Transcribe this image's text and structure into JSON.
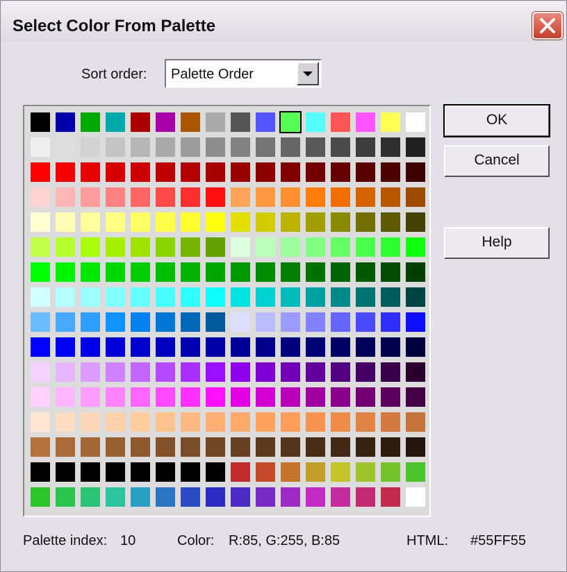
{
  "window": {
    "title": "Select Color From Palette",
    "close_icon": "close-icon"
  },
  "sort": {
    "label": "Sort order:",
    "value": "Palette Order"
  },
  "buttons": {
    "ok": "OK",
    "cancel": "Cancel",
    "help": "Help"
  },
  "status": {
    "index_label": "Palette index:",
    "index_value": "10",
    "color_label": "Color:",
    "color_value": "R:85, G:255, B:85",
    "html_label": "HTML:",
    "html_value": "#55FF55"
  },
  "palette": {
    "selected_index": 10,
    "rows": [
      [
        "#000000",
        "#0000aa",
        "#00aa00",
        "#00aaaa",
        "#aa0000",
        "#aa00aa",
        "#aa5500",
        "#aaaaaa",
        "#555555",
        "#5555ff",
        "#55ff55",
        "#55ffff",
        "#ff5555",
        "#ff55ff",
        "#ffff55",
        "#ffffff"
      ],
      [
        "#efefef",
        "#dedede",
        "#d2d2d2",
        "#c3c3c3",
        "#b6b6b6",
        "#aaaaaa",
        "#9d9d9d",
        "#8e8e8e",
        "#828282",
        "#757575",
        "#656565",
        "#595959",
        "#4a4a4a",
        "#3d3d3d",
        "#2f2f2f",
        "#202020"
      ],
      [
        "#ff0000",
        "#f40000",
        "#e70000",
        "#d90000",
        "#cd0000",
        "#bf0000",
        "#b30000",
        "#a60000",
        "#990000",
        "#8c0000",
        "#7f0000",
        "#720000",
        "#650000",
        "#590000",
        "#4c0000",
        "#3f0000"
      ],
      [
        "#ffd2d2",
        "#ffb6b6",
        "#ff9c9c",
        "#ff8282",
        "#ff6565",
        "#ff4a4a",
        "#ff2f2f",
        "#ff0f0f",
        "#ffa55a",
        "#ff9841",
        "#ff8f2f",
        "#ff7b0a",
        "#ef6f00",
        "#d46400",
        "#b75700",
        "#9c4b00"
      ],
      [
        "#ffffd2",
        "#ffffb6",
        "#ffff9c",
        "#ffff82",
        "#ffff65",
        "#ffff4a",
        "#ffff2f",
        "#ffff0f",
        "#e3e000",
        "#d2cc00",
        "#bbb300",
        "#a19f00",
        "#8a8a00",
        "#736f00",
        "#5d5a00",
        "#444200"
      ],
      [
        "#c3ff4a",
        "#b6ff2f",
        "#aaff0f",
        "#a5ef00",
        "#9ee300",
        "#8ad400",
        "#76b500",
        "#63a100",
        "#ddffdd",
        "#bbffbb",
        "#9cff9c",
        "#82ff82",
        "#65ff65",
        "#4aff4a",
        "#2fff2f",
        "#0fff0f"
      ],
      [
        "#00ff00",
        "#00f400",
        "#00e700",
        "#00d900",
        "#00cd00",
        "#00bf00",
        "#00b300",
        "#00a600",
        "#009900",
        "#008c00",
        "#007f00",
        "#007200",
        "#006500",
        "#005900",
        "#004c00",
        "#003f00"
      ],
      [
        "#d2ffff",
        "#b6ffff",
        "#9cffff",
        "#82ffff",
        "#65ffff",
        "#4affff",
        "#2fffff",
        "#0fffff",
        "#00e3e3",
        "#00d2d2",
        "#00bbbb",
        "#00a1a1",
        "#008a8a",
        "#007373",
        "#005d5d",
        "#004444"
      ],
      [
        "#6bbcff",
        "#47aaff",
        "#2f9fff",
        "#0f93ff",
        "#0083ef",
        "#0077d4",
        "#0068b7",
        "#005a9c",
        "#ddddff",
        "#bbbbff",
        "#9c9cff",
        "#8282ff",
        "#6565ff",
        "#4a4aff",
        "#2f2fff",
        "#0f0fff"
      ],
      [
        "#0000ff",
        "#0000f4",
        "#0000e7",
        "#0000d9",
        "#0000cd",
        "#0000bf",
        "#0000b3",
        "#0000a6",
        "#000099",
        "#00008c",
        "#00007f",
        "#000072",
        "#000065",
        "#000059",
        "#00004c",
        "#00003f"
      ],
      [
        "#f4d2ff",
        "#e7b6ff",
        "#dd9cff",
        "#d182ff",
        "#c365ff",
        "#b74aff",
        "#a82fff",
        "#9a0fff",
        "#8f00ef",
        "#8000d4",
        "#7100b7",
        "#62009c",
        "#540082",
        "#450065",
        "#38004a",
        "#29002f"
      ],
      [
        "#ffd2ff",
        "#ffb6ff",
        "#ff9cff",
        "#ff82ff",
        "#ff65ff",
        "#ff4aff",
        "#ff2fff",
        "#ff0fff",
        "#e300e3",
        "#d200d2",
        "#bb00bb",
        "#a100a1",
        "#8a008a",
        "#730073",
        "#5d005d",
        "#440044"
      ],
      [
        "#ffe5d2",
        "#ffddc3",
        "#ffd6b6",
        "#ffd0aa",
        "#ffcc9d",
        "#ffc38e",
        "#ffb982",
        "#ffb075",
        "#ffa96a",
        "#ffa25e",
        "#ff9d59",
        "#f7944f",
        "#ef8c4a",
        "#e38447",
        "#d47a41",
        "#c4733b"
      ],
      [
        "#b5723c",
        "#ab6b39",
        "#a26535",
        "#985f30",
        "#8e582d",
        "#84522a",
        "#7a4c27",
        "#714624",
        "#674021",
        "#5d3a1e",
        "#54341b",
        "#4a2e18",
        "#412815",
        "#372212",
        "#2e1c0f",
        "#24160c"
      ],
      [
        "#000000",
        "#000000",
        "#000000",
        "#000000",
        "#000000",
        "#000000",
        "#000000",
        "#000000",
        "#c12b2b",
        "#c44c2b",
        "#c4752b",
        "#c49e2b",
        "#c4c42b",
        "#9ec42b",
        "#75c42b",
        "#4cc42b"
      ],
      [
        "#2bc42b",
        "#2bc44c",
        "#2bc475",
        "#2bc49e",
        "#2b9ec4",
        "#2b75c4",
        "#2b4cc4",
        "#2b2bc4",
        "#4c2bc4",
        "#752bc4",
        "#9e2bc4",
        "#c42bc4",
        "#c42b9e",
        "#c42b75",
        "#c42b4c",
        "#ffffff"
      ]
    ]
  }
}
